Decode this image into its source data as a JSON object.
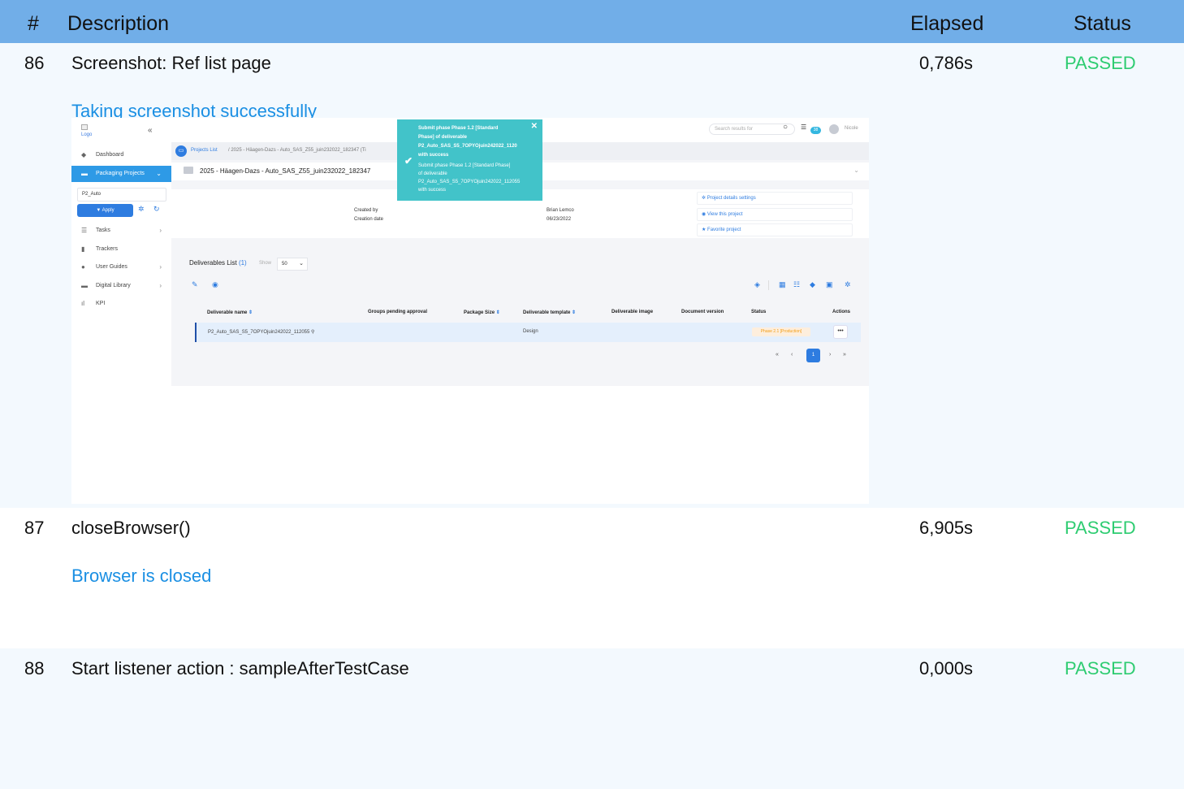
{
  "header": {
    "num": "#",
    "description": "Description",
    "elapsed": "Elapsed",
    "status": "Status"
  },
  "rows": [
    {
      "num": "86",
      "description": "Screenshot: Ref list page",
      "elapsed": "0,786s",
      "status": "PASSED",
      "message": "Taking screenshot successfully"
    },
    {
      "num": "87",
      "description": "closeBrowser()",
      "elapsed": "6,905s",
      "status": "PASSED",
      "message": "Browser is closed"
    },
    {
      "num": "88",
      "description": "Start listener action : sampleAfterTestCase",
      "elapsed": "0,000s",
      "status": "PASSED"
    }
  ],
  "colors": {
    "header_bg": "#71aee8",
    "passed": "#2ecc71",
    "message": "#1a8fe3",
    "accent": "#2e7ce0",
    "toast": "#42c3c9"
  },
  "screenshot": {
    "logo_alt": "Logo",
    "sidebar": {
      "items": [
        {
          "label": "Dashboard",
          "icon": "cube-icon"
        },
        {
          "label": "Packaging Projects",
          "icon": "folder-icon"
        },
        {
          "label": "Tasks",
          "icon": "list-icon"
        },
        {
          "label": "Trackers",
          "icon": "clipboard-icon"
        },
        {
          "label": "User Guides",
          "icon": "info-icon"
        },
        {
          "label": "Digital Library",
          "icon": "folder-icon"
        },
        {
          "label": "KPI",
          "icon": "bar-chart-icon"
        }
      ],
      "filter_value": "P2_Auto",
      "apply_label": "Apply"
    },
    "topbar": {
      "search_placeholder": "Search results for",
      "badge_count": "38",
      "user_name": "Nicole"
    },
    "breadcrumb": {
      "link": "Projects List",
      "rest": "/  2025 - Häagen-Dazs - Auto_SAS_Z55_juin232022_182347 (Ti"
    },
    "project_title": "2025 - Häagen-Dazs - Auto_SAS_Z55_juin232022_182347",
    "info": {
      "created_by_label": "Created by",
      "created_by_value": "Brian Lemco",
      "creation_date_label": "Creation date",
      "creation_date_value": "06/23/2022",
      "links": [
        "Project details settings",
        "View this project",
        "Favorite project"
      ]
    },
    "deliverables": {
      "title": "Deliverables List",
      "count": "(1)",
      "show_label": "Show",
      "show_value": "50",
      "columns": [
        "Deliverable name",
        "Groups pending approval",
        "Package Size",
        "Deliverable template",
        "Deliverable image",
        "Document version",
        "Status",
        "Actions"
      ],
      "rows": [
        {
          "name": "P2_Auto_SAS_S5_7OPYOjuin242022_112055",
          "template": "Design",
          "status": "Phase 2.1 [Production]"
        }
      ],
      "pager": {
        "first": "«",
        "prev": "‹",
        "page": "1",
        "next": "›",
        "last": "»"
      }
    },
    "toast": {
      "lines": [
        "Submit phase Phase 1.2 [Standard",
        "Phase] of deliverable",
        "P2_Auto_SAS_S5_7OPYOjuin242022_1120",
        "with success"
      ],
      "sub_lines": [
        "Submit phase Phase 1.2 [Standard Phase]",
        "of deliverable",
        "P2_Auto_SAS_S5_7OPYOjuin242022_112055",
        "with success"
      ]
    }
  }
}
